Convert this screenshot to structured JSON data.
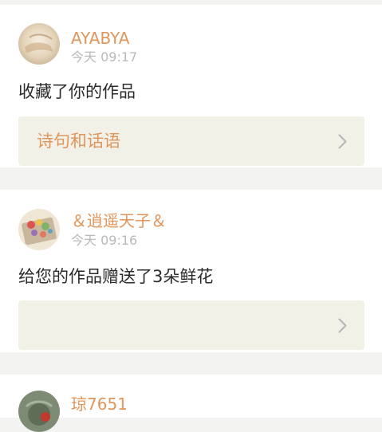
{
  "notifications": [
    {
      "username": "AYABYA",
      "time": "今天 09:17",
      "message": "收藏了你的作品",
      "work_title": "诗句和话语",
      "avatar_icon": "user-avatar"
    },
    {
      "username": "＆逍遥天子＆",
      "time": "今天 09:16",
      "message": "给您的作品赠送了3朵鲜花",
      "work_title": "",
      "avatar_icon": "user-avatar"
    },
    {
      "username": "琼7651",
      "avatar_icon": "user-avatar"
    }
  ],
  "colors": {
    "background": "#f3f3f1",
    "card": "#ffffff",
    "accent": "#e0955b",
    "muted": "#b9b9b9",
    "text": "#2b2b2b",
    "work_bg": "#f1f1e8"
  },
  "icons": {
    "chevron": "chevron-right-icon"
  }
}
